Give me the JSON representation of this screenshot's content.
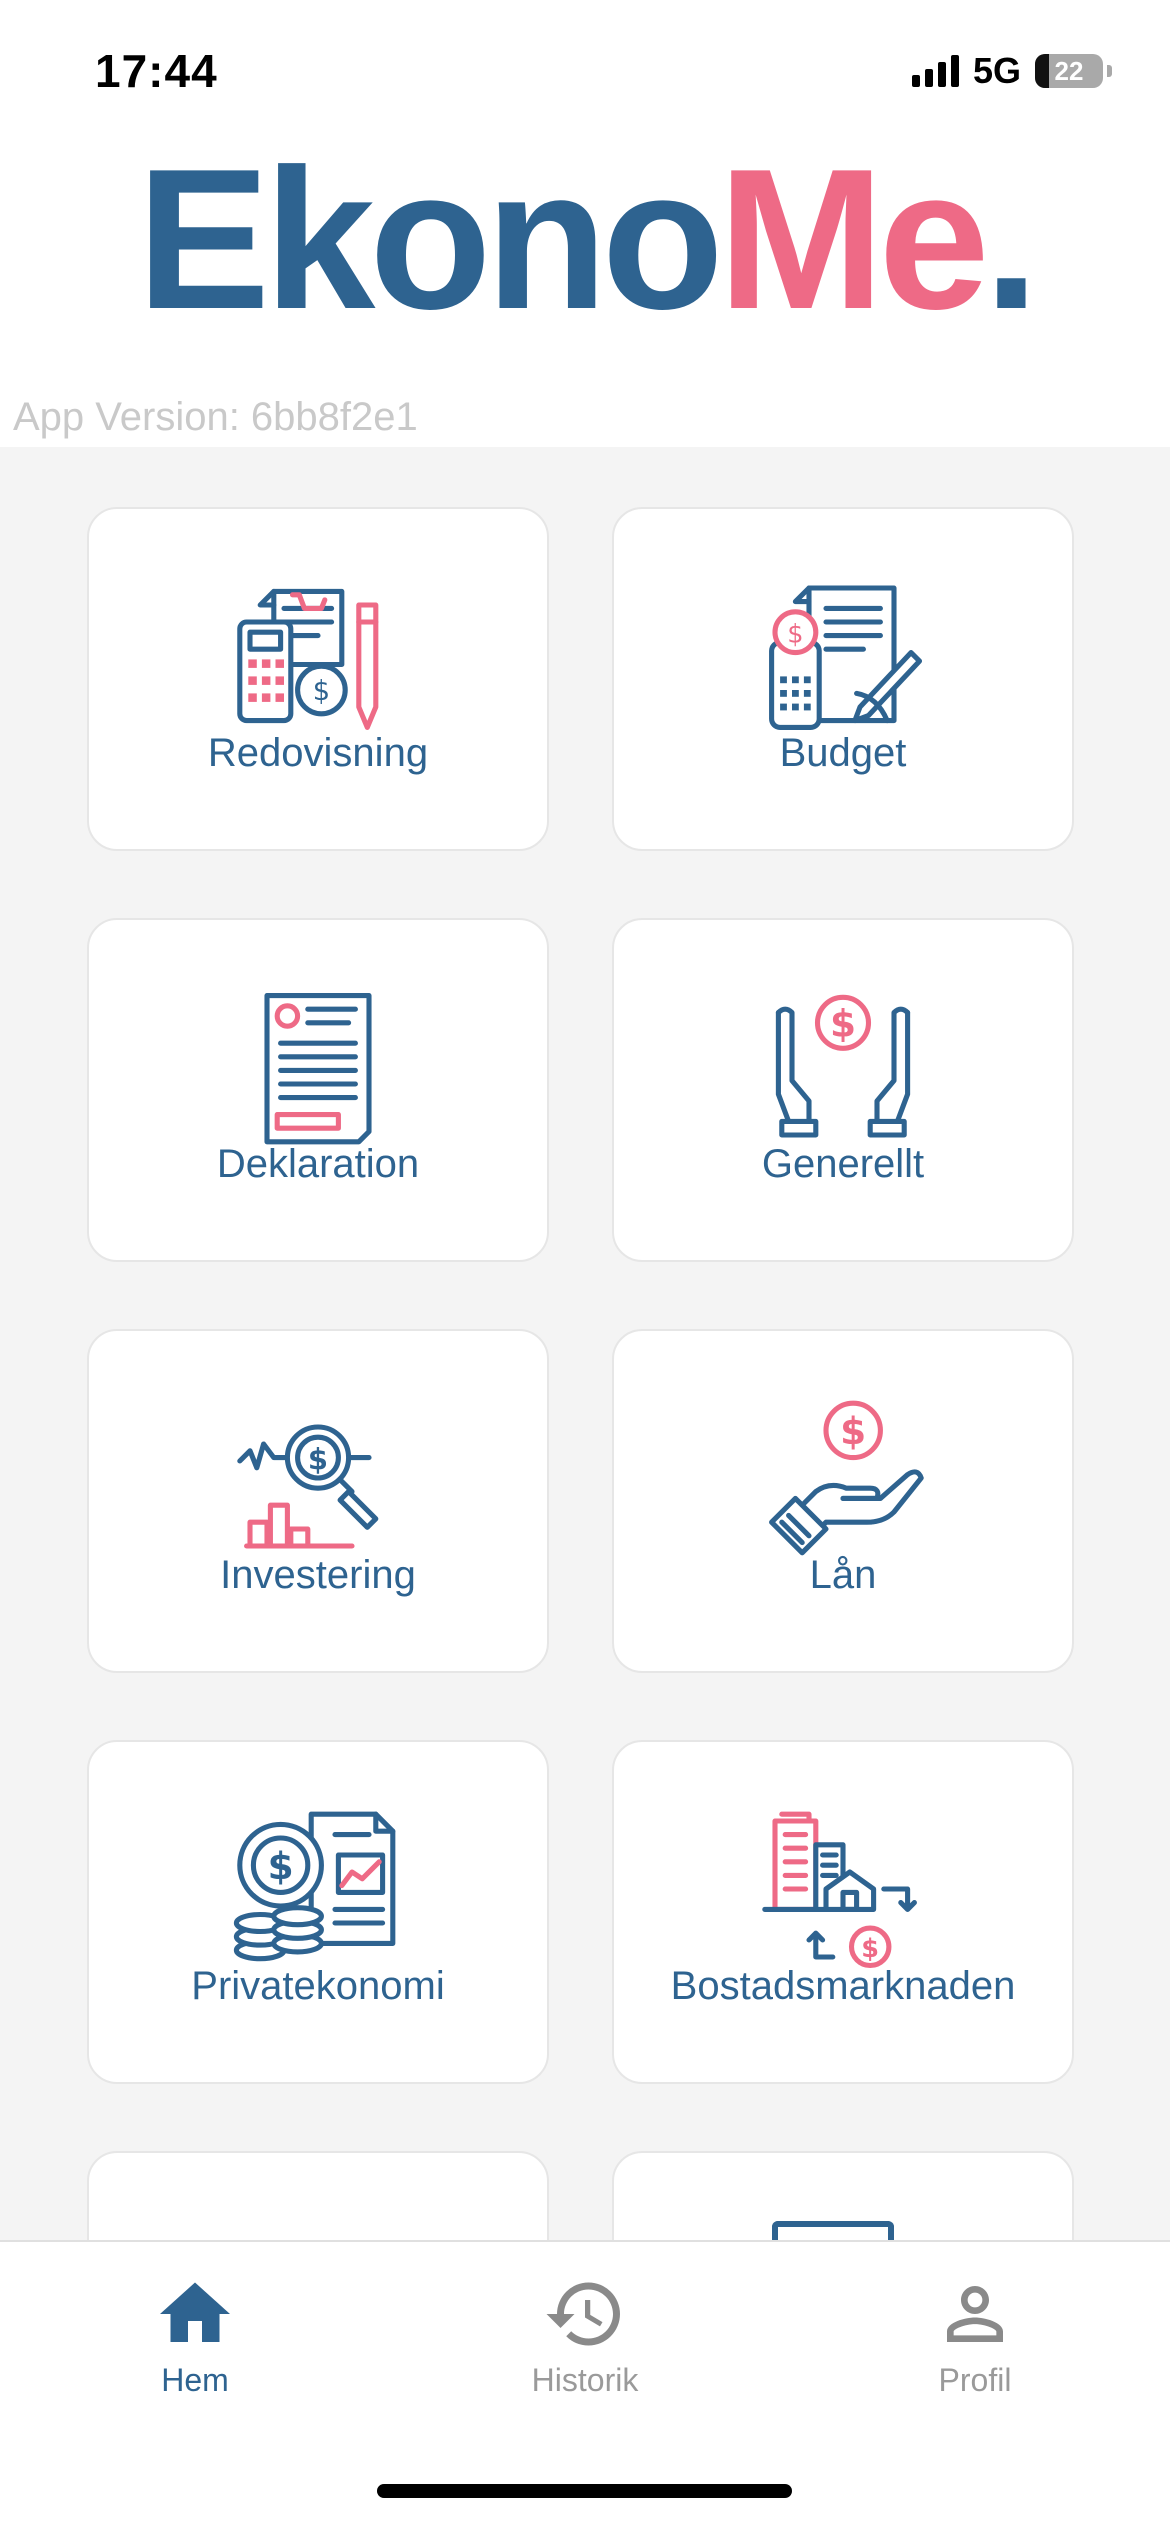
{
  "status": {
    "time": "17:44",
    "network": "5G",
    "battery": "22"
  },
  "logo": {
    "part1": "Ekono",
    "part2": "Me",
    "dot": "."
  },
  "app_version": "App Version: 6bb8f2e1",
  "colors": {
    "primary": "#2e6390",
    "accent": "#ee6a86"
  },
  "categories": [
    {
      "label": "Redovisning",
      "icon": "accounting-icon"
    },
    {
      "label": "Budget",
      "icon": "budget-icon"
    },
    {
      "label": "Deklaration",
      "icon": "tax-declaration-icon"
    },
    {
      "label": "Generellt",
      "icon": "hands-dollar-icon"
    },
    {
      "label": "Investering",
      "icon": "investment-magnifier-icon"
    },
    {
      "label": "Lån",
      "icon": "loan-hand-icon"
    },
    {
      "label": "Privatekonomi",
      "icon": "personal-finance-icon"
    },
    {
      "label": "Bostadsmarknaden",
      "icon": "housing-market-icon"
    }
  ],
  "nav": {
    "home": {
      "label": "Hem",
      "icon": "home-icon",
      "active": true
    },
    "history": {
      "label": "Historik",
      "icon": "history-icon"
    },
    "profile": {
      "label": "Profil",
      "icon": "profile-icon"
    }
  }
}
